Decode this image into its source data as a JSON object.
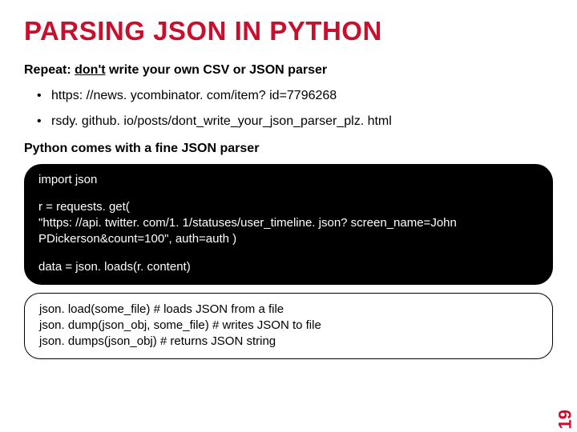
{
  "title": "PARSING JSON IN PYTHON",
  "subhead_prefix": "Repeat: ",
  "subhead_emph": "don't",
  "subhead_suffix": " write your own CSV or JSON parser",
  "bullets": [
    "https: //news. ycombinator. com/item? id=7796268",
    "rsdy. github. io/posts/dont_write_your_json_parser_plz. html"
  ],
  "sub2": "Python comes with a fine JSON parser",
  "code1": {
    "l1": "import json",
    "l2": "r = requests. get(",
    "l3": "\"https: //api. twitter. com/1. 1/statuses/user_timeline. json? screen_name=John",
    "l4": "PDickerson&count=100\", auth=auth )",
    "l5": "data = json. loads(r. content)"
  },
  "code2": {
    "l1": "json. load(some_file)  # loads JSON from a file",
    "l2": "json. dump(json_obj, some_file)  # writes JSON to file",
    "l3": "json. dumps(json_obj)  # returns JSON string"
  },
  "pagenum": "19"
}
